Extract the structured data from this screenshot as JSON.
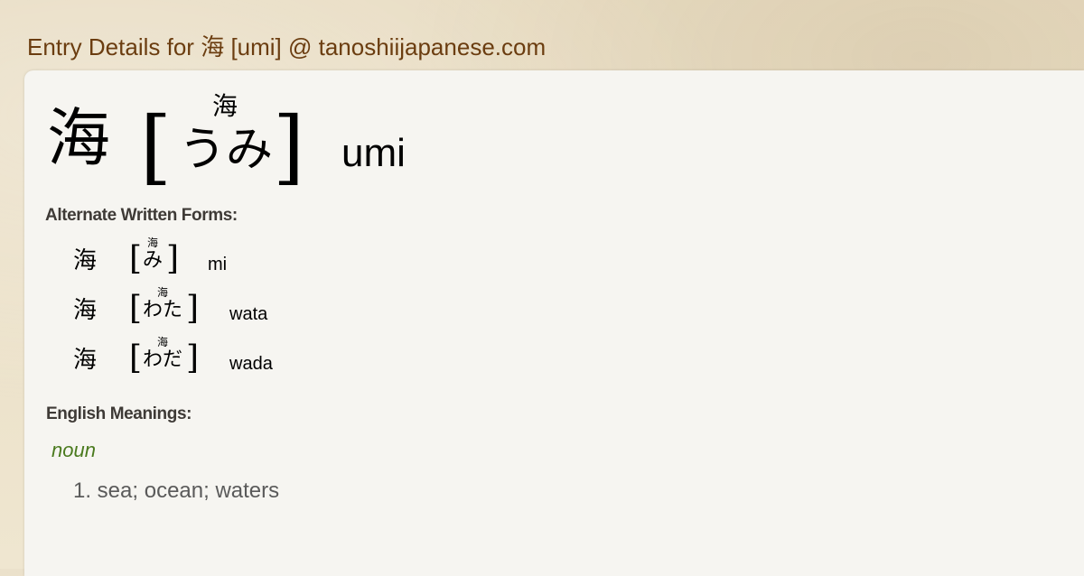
{
  "header": {
    "prefix": "Entry Details for",
    "word": "海",
    "suffix": "[umi] @ tanoshiijapanese.com"
  },
  "entry": {
    "kanji": "海",
    "bracket_open": "[",
    "bracket_close": "]",
    "furigana": "海",
    "reading": "うみ",
    "romaji": "umi"
  },
  "alternate": {
    "label": "Alternate Written Forms:",
    "forms": [
      {
        "kanji": "海",
        "furigana": "海",
        "reading": "み",
        "romaji": "mi"
      },
      {
        "kanji": "海",
        "furigana": "海",
        "reading": "わた",
        "romaji": "wata"
      },
      {
        "kanji": "海",
        "furigana": "海",
        "reading": "わだ",
        "romaji": "wada"
      }
    ]
  },
  "meanings": {
    "label": "English Meanings:",
    "part_of_speech": "noun",
    "items": [
      "1. sea; ocean; waters"
    ]
  },
  "colors": {
    "header_text": "#6b3d10",
    "pos_text": "#4a7a1e",
    "meaning_text": "#5a5a5a",
    "panel_bg": "#f6f5f1"
  }
}
